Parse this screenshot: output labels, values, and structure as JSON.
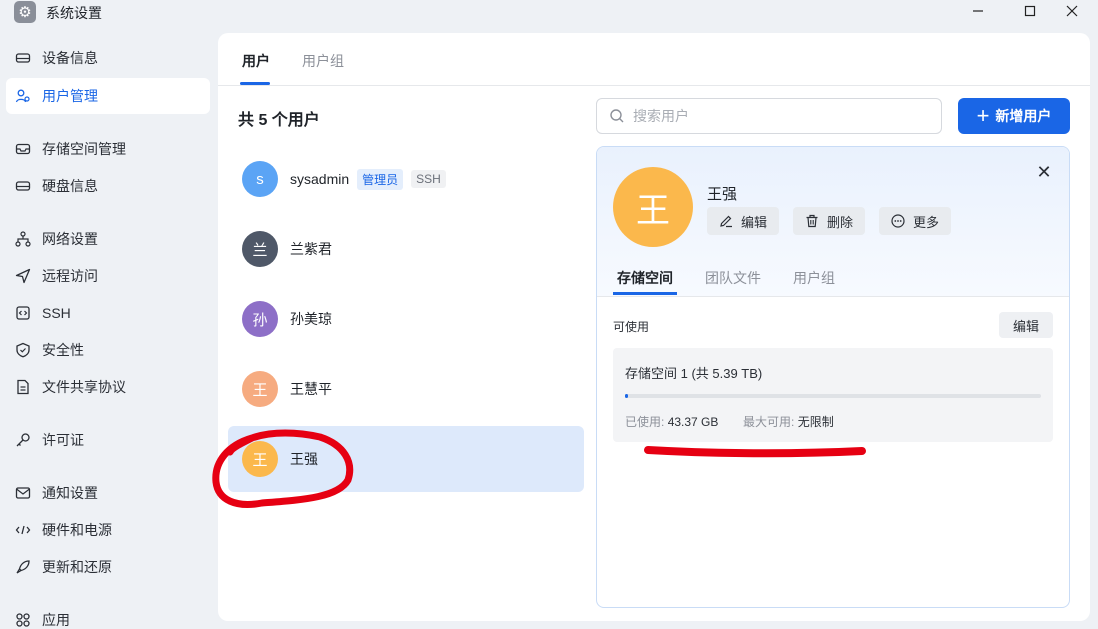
{
  "window": {
    "title": "系统设置",
    "icon": "gear-icon"
  },
  "sidebar": {
    "items": [
      {
        "label": "设备信息",
        "icon": "device-icon"
      },
      {
        "label": "用户管理",
        "icon": "users-icon",
        "active": true
      },
      {
        "label": "存储空间管理",
        "icon": "storage-icon"
      },
      {
        "label": "硬盘信息",
        "icon": "disk-icon"
      },
      {
        "label": "网络设置",
        "icon": "network-icon"
      },
      {
        "label": "远程访问",
        "icon": "send-icon"
      },
      {
        "label": "SSH",
        "icon": "code-icon"
      },
      {
        "label": "安全性",
        "icon": "shield-icon"
      },
      {
        "label": "文件共享协议",
        "icon": "file-icon"
      },
      {
        "label": "许可证",
        "icon": "key-icon"
      },
      {
        "label": "通知设置",
        "icon": "mail-icon"
      },
      {
        "label": "硬件和电源",
        "icon": "power-icon"
      },
      {
        "label": "更新和还原",
        "icon": "rocket-icon"
      },
      {
        "label": "应用",
        "icon": "apps-icon"
      }
    ]
  },
  "tabs": {
    "users": "用户",
    "groups": "用户组"
  },
  "user_count": "共 5 个用户",
  "search": {
    "placeholder": "搜索用户"
  },
  "add_button": "新增用户",
  "users": [
    {
      "name": "sysadmin",
      "initial": "s",
      "color": "#5ba4f5",
      "badges": [
        "管理员",
        "SSH"
      ]
    },
    {
      "name": "兰紫君",
      "initial": "兰",
      "color": "#4f5868"
    },
    {
      "name": "孙美琼",
      "initial": "孙",
      "color": "#8d6fc7"
    },
    {
      "name": "王慧平",
      "initial": "王",
      "color": "#f6ab80"
    },
    {
      "name": "王强",
      "initial": "王",
      "color": "#fbb84c",
      "selected": true
    }
  ],
  "detail": {
    "name": "王强",
    "initial": "王",
    "actions": {
      "edit": "编辑",
      "delete": "删除",
      "more": "更多"
    },
    "tabs": {
      "storage": "存储空间",
      "team_files": "团队文件",
      "groups": "用户组"
    },
    "available_label": "可使用",
    "edit_button": "编辑",
    "storage": {
      "title": "存储空间 1 (共 5.39 TB)",
      "used_label": "已使用:",
      "used_value": "43.37 GB",
      "max_label": "最大可用:",
      "max_value": "无限制",
      "used_fraction": 0.008
    }
  },
  "colors": {
    "accent": "#1a66e6",
    "annotation": "#e60012"
  }
}
